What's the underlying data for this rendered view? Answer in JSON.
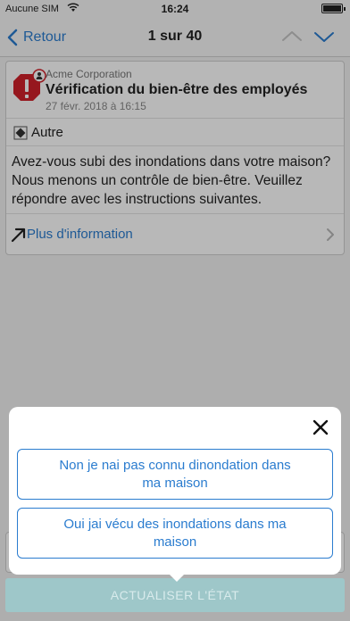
{
  "status_bar": {
    "carrier": "Aucune SIM",
    "time": "16:24"
  },
  "nav": {
    "back_label": "Retour",
    "title": "1 sur 40"
  },
  "message": {
    "company": "Acme Corporation",
    "title": "Vérification du bien-être des employés",
    "date": "27 févr. 2018 à 16:15",
    "category": "Autre",
    "body": "Avez-vous subi des inondations dans votre maison? Nous menons un contrôle de bien-être. Veuillez répondre avec les instructions suivantes.",
    "more_info": "Plus d'information"
  },
  "modal": {
    "options": [
      {
        "label": "Non je nai pas connu dinondation dans ma maison"
      },
      {
        "label": "Oui jai vécu des inondations dans ma maison"
      }
    ]
  },
  "footer": {
    "update_label": "ACTUALISER L'ÉTAT"
  },
  "colors": {
    "accent": "#2a7ccf",
    "alert": "#d0212a",
    "update_button": "#9ec7c9"
  }
}
